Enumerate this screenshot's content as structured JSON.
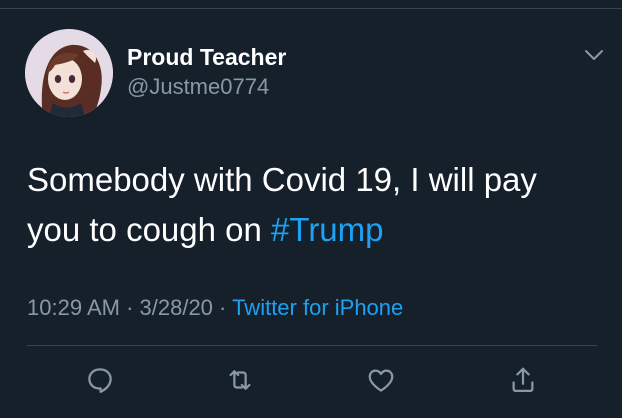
{
  "tweet": {
    "author": {
      "display_name": "Proud Teacher",
      "handle": "@Justme0774",
      "avatar_icon": "avatar-illustration-icon"
    },
    "text_before_hashtag": "Somebody with Covid 19, I will pay you to cough on ",
    "hashtag": "#Trump",
    "time": "10:29 AM",
    "separator": " · ",
    "date": "3/28/20",
    "source": "Twitter for iPhone"
  },
  "actions": [
    {
      "name": "reply",
      "icon": "reply-icon"
    },
    {
      "name": "retweet",
      "icon": "retweet-icon"
    },
    {
      "name": "like",
      "icon": "heart-icon"
    },
    {
      "name": "share",
      "icon": "share-icon"
    }
  ],
  "colors": {
    "background": "#15202b",
    "text": "#ffffff",
    "secondary_text": "#8899a6",
    "link": "#1da1f2",
    "divider": "#38444d"
  }
}
